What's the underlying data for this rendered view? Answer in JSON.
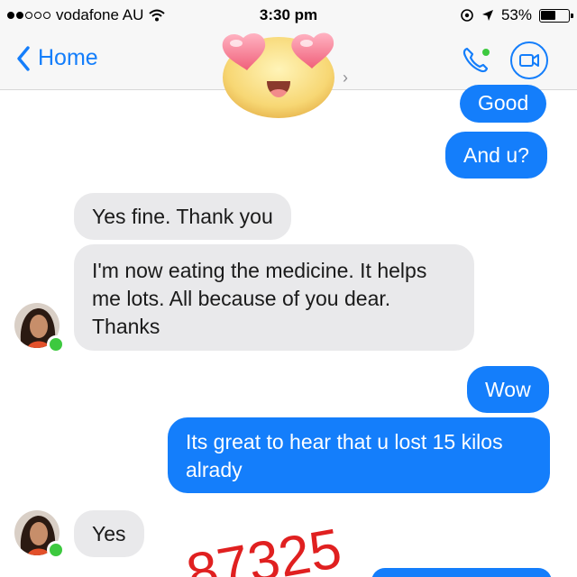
{
  "status_bar": {
    "carrier": "vodafone AU",
    "time": "3:30 pm",
    "battery": "53%",
    "battery_level": 0.53,
    "signal_dots_filled": 2,
    "signal_dots_total": 5
  },
  "nav": {
    "back_label": "Home",
    "icons": [
      "back-chevron-icon",
      "phone-icon",
      "video-camera-icon",
      "heart-eyes-emoji-icon"
    ],
    "accent_color": "#147efb"
  },
  "messages": [
    {
      "side": "out",
      "text": "Good"
    },
    {
      "side": "out",
      "text": "And u?"
    },
    {
      "side": "in",
      "text": "Yes fine. Thank you"
    },
    {
      "side": "in",
      "text": "I'm now eating the medicine. It helps me lots. All because of you dear. Thanks"
    },
    {
      "side": "out",
      "text": "Wow"
    },
    {
      "side": "out",
      "text": "Its great to hear that u lost 15 kilos alrady"
    },
    {
      "side": "in",
      "text": "Yes"
    }
  ],
  "watermark": {
    "text": "87325",
    "color": "#e02020"
  },
  "colors": {
    "outgoing_bubble": "#147efb",
    "incoming_bubble": "#e9e9eb",
    "online_dot": "#3dc93f"
  }
}
